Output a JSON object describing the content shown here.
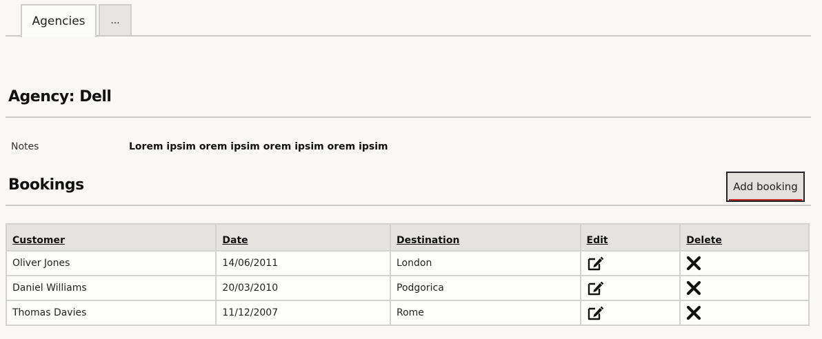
{
  "tabs": {
    "items": [
      {
        "label": "Agencies"
      },
      {
        "label": "..."
      }
    ]
  },
  "agency": {
    "title": "Agency: Dell",
    "notes_label": "Notes",
    "notes_value": "Lorem ipsim orem ipsim orem ipsim orem ipsim"
  },
  "bookings": {
    "title": "Bookings",
    "add_button_label": "Add booking",
    "columns": [
      "Customer",
      "Date",
      "Destination",
      "Edit",
      "Delete"
    ],
    "rows": [
      {
        "customer": "Oliver Jones",
        "date": "14/06/2011",
        "destination": "London",
        "edit_icon": "edit-icon",
        "delete_icon": "close-icon"
      },
      {
        "customer": "Daniel Williams",
        "date": "20/03/2010",
        "destination": "Podgorica",
        "edit_icon": "edit-icon",
        "delete_icon": "close-icon"
      },
      {
        "customer": "Thomas Davies",
        "date": "11/12/2007",
        "destination": "Rome",
        "edit_icon": "edit-icon",
        "delete_icon": "close-icon"
      }
    ]
  },
  "colors": {
    "button_underline": "#c0262d",
    "header_bg": "#e4e3e0",
    "border": "#d2d2d2"
  }
}
